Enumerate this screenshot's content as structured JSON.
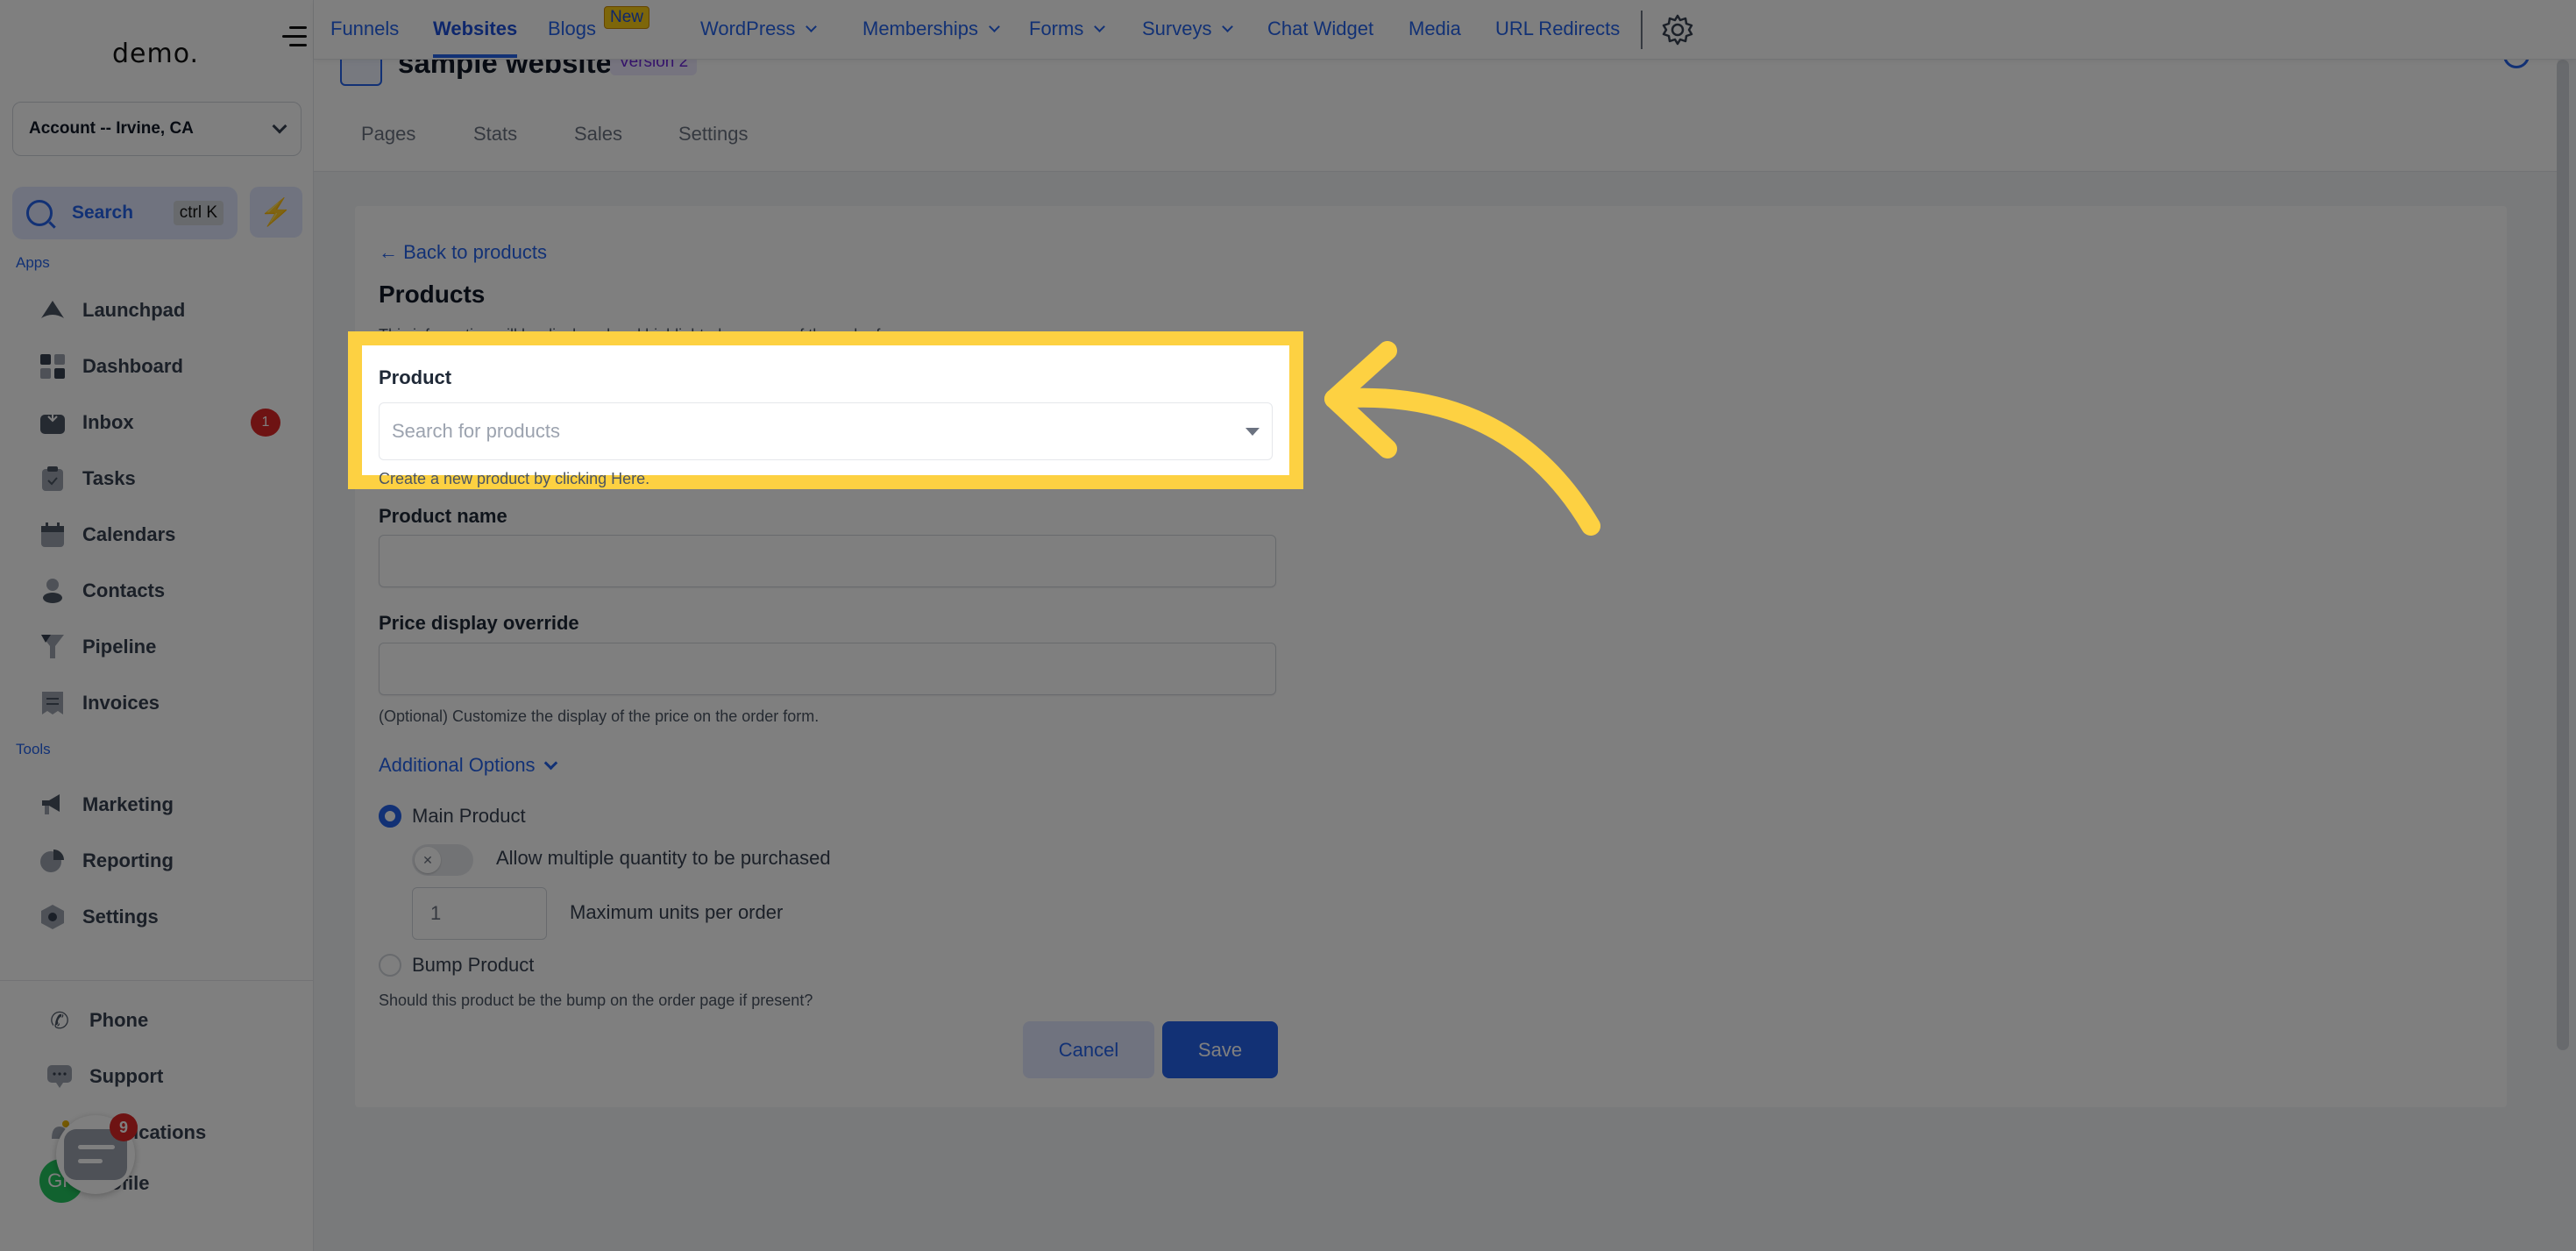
{
  "sidebar": {
    "logo": "demo.",
    "account": "Account -- Irvine, CA",
    "search_label": "Search",
    "search_shortcut": "ctrl K",
    "apps_label": "Apps",
    "tools_label": "Tools",
    "apps": [
      {
        "label": "Launchpad",
        "icon": "rocket-icon"
      },
      {
        "label": "Dashboard",
        "icon": "dashboard-icon"
      },
      {
        "label": "Inbox",
        "icon": "inbox-icon",
        "badge": "1"
      },
      {
        "label": "Tasks",
        "icon": "clipboard-icon"
      },
      {
        "label": "Calendars",
        "icon": "calendar-icon"
      },
      {
        "label": "Contacts",
        "icon": "contact-icon"
      },
      {
        "label": "Pipeline",
        "icon": "funnel-icon"
      },
      {
        "label": "Invoices",
        "icon": "invoice-icon"
      }
    ],
    "tools": [
      {
        "label": "Marketing",
        "icon": "megaphone-icon"
      },
      {
        "label": "Reporting",
        "icon": "pie-chart-icon"
      },
      {
        "label": "Settings",
        "icon": "settings-icon"
      }
    ],
    "bottom": [
      {
        "label": "Phone",
        "icon": "phone-icon"
      },
      {
        "label": "Support",
        "icon": "support-icon"
      },
      {
        "label": "Notifications",
        "icon": "bell-icon"
      },
      {
        "label": "Profile",
        "icon": "avatar-icon"
      }
    ],
    "avatar_initials": "GP",
    "chat_badge": "9"
  },
  "topnav": {
    "items": [
      {
        "label": "Funnels"
      },
      {
        "label": "Websites",
        "active": true
      },
      {
        "label": "Blogs",
        "badge": "New"
      },
      {
        "label": "WordPress",
        "dropdown": true
      },
      {
        "label": "Memberships",
        "dropdown": true
      },
      {
        "label": "Forms",
        "dropdown": true
      },
      {
        "label": "Surveys",
        "dropdown": true
      },
      {
        "label": "Chat Widget"
      },
      {
        "label": "Media"
      },
      {
        "label": "URL Redirects"
      }
    ]
  },
  "header": {
    "title": "sample website",
    "version": "Version 2",
    "tabs": [
      "Pages",
      "Stats",
      "Sales",
      "Settings"
    ]
  },
  "form": {
    "back_link": "Back to products",
    "title": "Products",
    "description": "This information will be displayed and highlighted on every of the order form.",
    "product_label": "Product",
    "product_placeholder": "Search for products",
    "product_help": "Create a new product by clicking Here.",
    "product_name_label": "Product name",
    "product_name_value": "",
    "price_override_label": "Price display override",
    "price_override_value": "",
    "price_override_help": "(Optional) Customize the display of the price on the order form.",
    "additional_options": "Additional Options",
    "main_product_label": "Main Product",
    "main_product_selected": true,
    "allow_multiple_label": "Allow multiple quantity to be purchased",
    "allow_multiple_enabled": false,
    "max_units_value": "1",
    "max_units_label": "Maximum units per order",
    "bump_product_label": "Bump Product",
    "bump_product_selected": false,
    "bump_help": "Should this product be the bump on the order page if present?",
    "cancel_label": "Cancel",
    "save_label": "Save"
  },
  "colors": {
    "accent": "#2563eb",
    "highlight": "#fdd142",
    "badge_red": "#dc2626"
  }
}
